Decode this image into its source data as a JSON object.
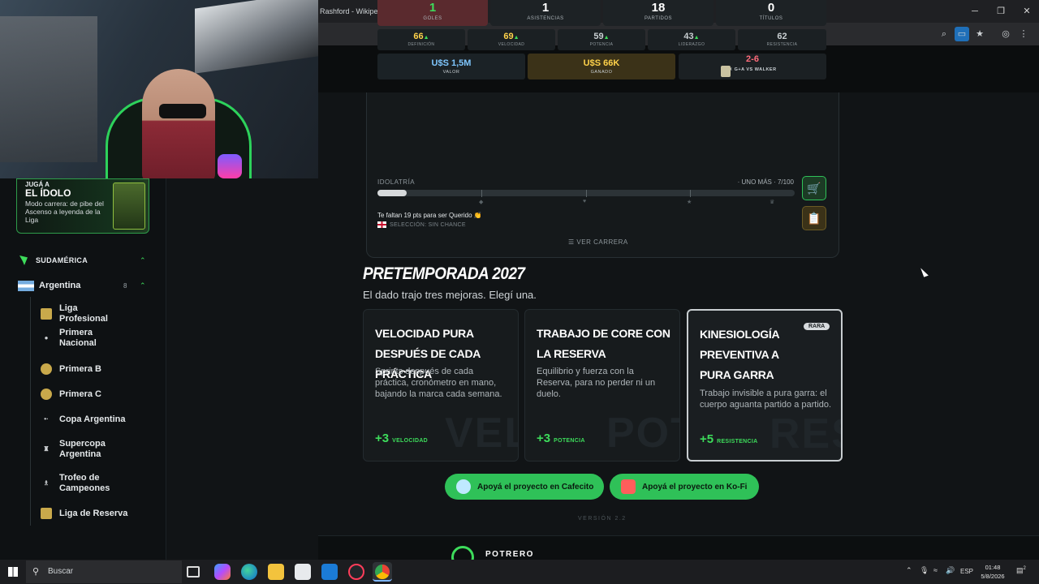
{
  "browser": {
    "tab_title": "Rashford - Wikipedia, la",
    "new_tab": "+",
    "window_buttons": [
      "─",
      "❐",
      "✕"
    ],
    "toolbar_icons": [
      "zoom-icon",
      "cast-icon",
      "bookmark-star-icon",
      "profile-icon",
      "kebab-menu-icon"
    ]
  },
  "sidebar": {
    "promo": {
      "kicker": "JUGÁ A",
      "title": "EL ÍDOLO",
      "description": "Modo carrera: de pibe del Ascenso a leyenda de la Liga"
    },
    "region": {
      "label": "SUDAMÉRICA",
      "chevron": "⌃"
    },
    "country": {
      "name": "Argentina",
      "count": "8",
      "chevron": "⌃"
    },
    "leagues": [
      {
        "name": "Liga Profesional"
      },
      {
        "name": "Primera Nacional"
      },
      {
        "name": "Primera B"
      },
      {
        "name": "Primera C"
      },
      {
        "name": "Copa Argentina"
      },
      {
        "name": "Supercopa Argentina"
      },
      {
        "name": "Trofeo de Campeones"
      },
      {
        "name": "Liga de Reserva"
      }
    ]
  },
  "stats": [
    {
      "value": "1",
      "label": "GOLES"
    },
    {
      "value": "1",
      "label": "ASISTENCIAS"
    },
    {
      "value": "18",
      "label": "PARTIDOS"
    },
    {
      "value": "0",
      "label": "TÍTULOS"
    }
  ],
  "attributes": [
    {
      "value": "66",
      "label": "DEFINICIÓN",
      "arrow": "▲"
    },
    {
      "value": "69",
      "label": "VELOCIDAD",
      "arrow": "▲"
    },
    {
      "value": "59",
      "label": "POTENCIA",
      "arrow": "▲"
    },
    {
      "value": "43",
      "label": "LIDERAZGO",
      "arrow": "▲"
    },
    {
      "value": "62",
      "label": "RESISTENCIA",
      "arrow": ""
    }
  ],
  "money": [
    {
      "value": "U$S 1,5M",
      "label": "VALOR"
    },
    {
      "value": "U$S 66K",
      "label": "GANADO"
    }
  ],
  "rivalry": {
    "score": "2-6",
    "label": "G+A VS WALKER",
    "cross": "✕"
  },
  "idolatria": {
    "label": "IDOLATRÍA",
    "status": "· UNO MÁS · 7/100",
    "progress": 0.07,
    "milestone_icons": [
      "◆",
      "♥",
      "★",
      "♛"
    ],
    "hint": "Te faltan 19 pts para ser Querido 👏",
    "seleccion": "SELECCIÓN: SIN CHANCE",
    "ver_carrera": "VER CARRERA",
    "ver_carrera_icon": "☰"
  },
  "side_buttons": [
    "🛒",
    "📋"
  ],
  "pretemporada": {
    "title": "PRETEMPORADA 2027",
    "subtitle": "El dado trajo tres mejoras. Elegí una.",
    "options": [
      {
        "title": "VELOCIDAD PURA DESPUÉS DE CADA PRÁCTICA",
        "description": "Sprints después de cada práctica, cronómetro en mano, bajando la marca cada semana.",
        "bonus": "+3",
        "stat": "VELOCIDAD",
        "watermark": "VEL",
        "badge": ""
      },
      {
        "title": "TRABAJO DE CORE CON LA RESERVA",
        "description": "Equilibrio y fuerza con la Reserva, para no perder ni un duelo.",
        "bonus": "+3",
        "stat": "POTENCIA",
        "watermark": "POT",
        "badge": ""
      },
      {
        "title": "KINESIOLOGÍA PREVENTIVA A PURA GARRA",
        "description": "Trabajo invisible a pura garra: el cuerpo aguanta partido a partido.",
        "bonus": "+5",
        "stat": "RESISTENCIA",
        "watermark": "RES",
        "badge": "RARA"
      }
    ]
  },
  "support": [
    {
      "label": "Apoyá el proyecto en Cafecito"
    },
    {
      "label": "Apoyá el proyecto en Ko-Fi"
    }
  ],
  "version": "VERSIÓN 2.2",
  "footer": {
    "brand": "POTRERO",
    "logo": "2"
  },
  "taskbar": {
    "search": "Buscar",
    "language": "ESP",
    "time": "01:48",
    "date": "5/8/2026",
    "notifications": "2"
  },
  "colors": {
    "accent": "#3ddc5b",
    "goles_bg": "#5a2a2e",
    "value_blue": "#7fc7ff",
    "earned_bg": "#3b3218",
    "earned_text": "#ffd24a",
    "rivalry": "#ff6b7a"
  }
}
